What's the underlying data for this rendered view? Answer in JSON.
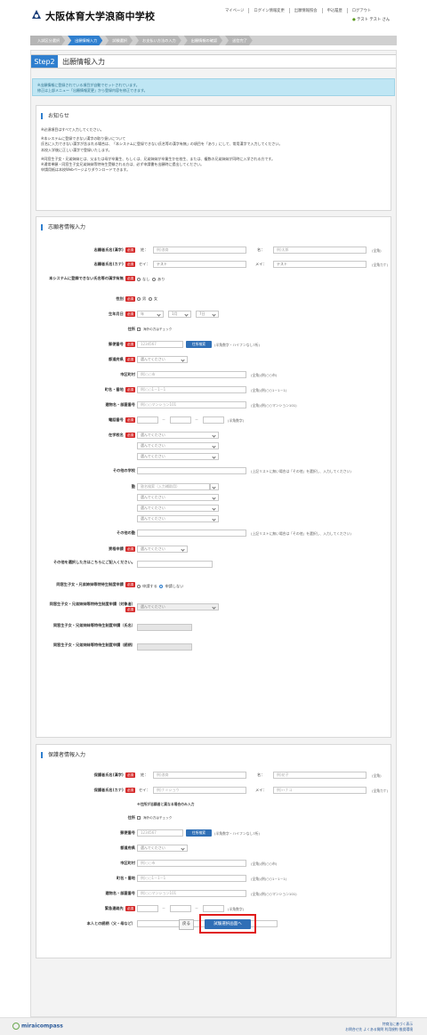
{
  "header": {
    "school_name": "大阪体育大学浪商中学校",
    "nav": [
      "マイページ",
      "ログイン情報変更",
      "出願情報照会",
      "申込履歴",
      "ログアウト"
    ],
    "user": "テスト テスト さん",
    "user_icon": "person-icon"
  },
  "steps": [
    "入試区分選択",
    "出願情報入力",
    "試験選択",
    "お支払い方法の入力",
    "出願情報の確認",
    "送信完了"
  ],
  "step_title": {
    "no": "Step2",
    "name": "出願情報入力"
  },
  "info": [
    "※出願情報に登録されている項目が自動でセットされています。",
    "修正は上部メニュー「出願情報変更」から登録内容を修正できます。"
  ],
  "notice": {
    "title": "お知らせ",
    "lines": [
      "※必須項目はすべて入力してください。",
      "※本システムに登録できない漢字の取り扱いについて",
      "氏名に入力できない漢字が含まれる場合は、「本システムに登録できない氏名等の漢字有無」の項目を「あり」にして、常用漢字で入力してください。",
      "本校入学後に正しい漢字で登録いたします。",
      "※同窓生子女・兄弟姉妹とは、父または母が卒業生、もしくは、兄弟姉妹が卒業生か在校生、または、複数の兄弟姉妹が同時に入学される方です。",
      "※通常単願・同窓生子女兄弟姉妹等特待生受験される方は、必ず申請書を出願時に提出してください。",
      "申請用紙は本校Webページよりダウンロードできます。"
    ]
  },
  "applicant": {
    "title": "志願者情報入力",
    "req": "必須",
    "name_kanji": {
      "label": "志願者氏名(漢字)",
      "sei": "姓：",
      "mei": "名：",
      "sei_ph": "例)浪商",
      "mei_ph": "例)太郎",
      "note": "(全角)"
    },
    "name_kana": {
      "label": "志願者氏名(カナ)",
      "sei": "セイ：",
      "mei": "メイ：",
      "sei_val": "テスト",
      "mei_val": "テスト",
      "note": "(全角カナ)"
    },
    "kanji_flag": {
      "label": "本システムに登録できない氏名等の漢字有無",
      "opt1": "なし",
      "opt2": "あり"
    },
    "gender": {
      "label": "性別",
      "opt1": "男",
      "opt2": "女"
    },
    "birth": {
      "label": "生年月日",
      "year": "年",
      "month": "1月",
      "day": "7日"
    },
    "address": {
      "label": "住所",
      "check": "海外の方はチェック"
    },
    "zip": {
      "label": "郵便番号",
      "ph": "1234567",
      "btn": "住所検索",
      "note": "(半角数字・ハイフンなし7桁)"
    },
    "pref": {
      "label": "都道府県",
      "ph": "選んでください"
    },
    "city": {
      "label": "市区町村",
      "ph": "例)○○市",
      "note": "(全角)(例)○○市)"
    },
    "street": {
      "label": "町名・番地",
      "ph": "例)○○1－1－1",
      "note": "(全角)(例)○○1－1－1)"
    },
    "building": {
      "label": "建物名・部屋番号",
      "ph": "例)○○マンション101",
      "note": "(全角)(例)○○マンション101)"
    },
    "phone": {
      "label": "電話番号",
      "note": "(半角数字)"
    },
    "school": {
      "label": "在学校名",
      "ph": "選んでください"
    },
    "other_school": {
      "label": "その他の学校",
      "note": "(上記リストに無い場合は「その他」を選択し、入力してください)"
    },
    "juku": {
      "label": "塾",
      "ph": "塾名検索（入力補助用）",
      "ph2": "選んでください"
    },
    "other_juku": {
      "label": "その他の塾",
      "note": "(上記リストに無い場合は「その他」を選択し、入力してください)"
    },
    "exam_type": {
      "label": "資格申請",
      "ph": "選んでください"
    },
    "other_note": {
      "label": "その他を選択した方はこちらにご記入ください。"
    },
    "sibling": {
      "label": "同窓生子女・兄弟姉妹等特待生制度申請",
      "opt1": "申請する",
      "opt2": "申請しない"
    },
    "sibling_target": {
      "label": "同窓生子女・兄弟姉妹等特待生制度申請（対象者）",
      "ph": "選んでください"
    },
    "sibling_name": {
      "label": "同窓生子女・兄弟姉妹等特待生制度申請（氏名）"
    },
    "sibling_rel": {
      "label": "同窓生子女・兄弟姉妹等特待生制度申請（続柄）"
    }
  },
  "guardian": {
    "title": "保護者情報入力",
    "name_kanji": {
      "label": "保護者氏名(漢字)",
      "sei": "姓：",
      "mei": "名：",
      "sei_ph": "例)浪商",
      "mei_ph": "例)花子",
      "note": "(全角)"
    },
    "name_kana": {
      "label": "保護者氏名(カナ)",
      "sei": "セイ：",
      "mei": "メイ：",
      "sei_ph": "例)ナミショウ",
      "mei_ph": "例)ハナコ",
      "note": "(全角カナ)"
    },
    "addr_note": "※住所が志願者と異なる場合のみ入力",
    "address": {
      "label": "住所",
      "check": "海外の方はチェック"
    },
    "zip": {
      "label": "郵便番号",
      "ph": "1234567",
      "btn": "住所検索",
      "note": "(半角数字・ハイフンなし7桁)"
    },
    "pref": {
      "label": "都道府県",
      "ph": "選んでください"
    },
    "city": {
      "label": "市区町村",
      "ph": "例)○○市",
      "note": "(全角)(例)○○市)"
    },
    "street": {
      "label": "町名・番地",
      "ph": "例)○○1－1－1",
      "note": "(全角)(例)○○1－1－1)"
    },
    "building": {
      "label": "建物名・部屋番号",
      "ph": "例)○○マンション101",
      "note": "(全角)(例)○○マンション101)"
    },
    "emergency": {
      "label": "緊急連絡先",
      "note": "(半角数字)"
    },
    "relation": {
      "label": "本人との続柄（父・母など）"
    }
  },
  "buttons": {
    "back": "戻る",
    "next": "試験選択画面へ"
  },
  "footer": {
    "brand": "miraicompass",
    "links1": "特商法に基づく表示",
    "links2": "お問合せ先  よくある質問  利用規約  推奨環境"
  },
  "colors": {
    "accent": "#2f7fcf",
    "required": "#d52b2b",
    "highlight": "#e01b1b"
  }
}
